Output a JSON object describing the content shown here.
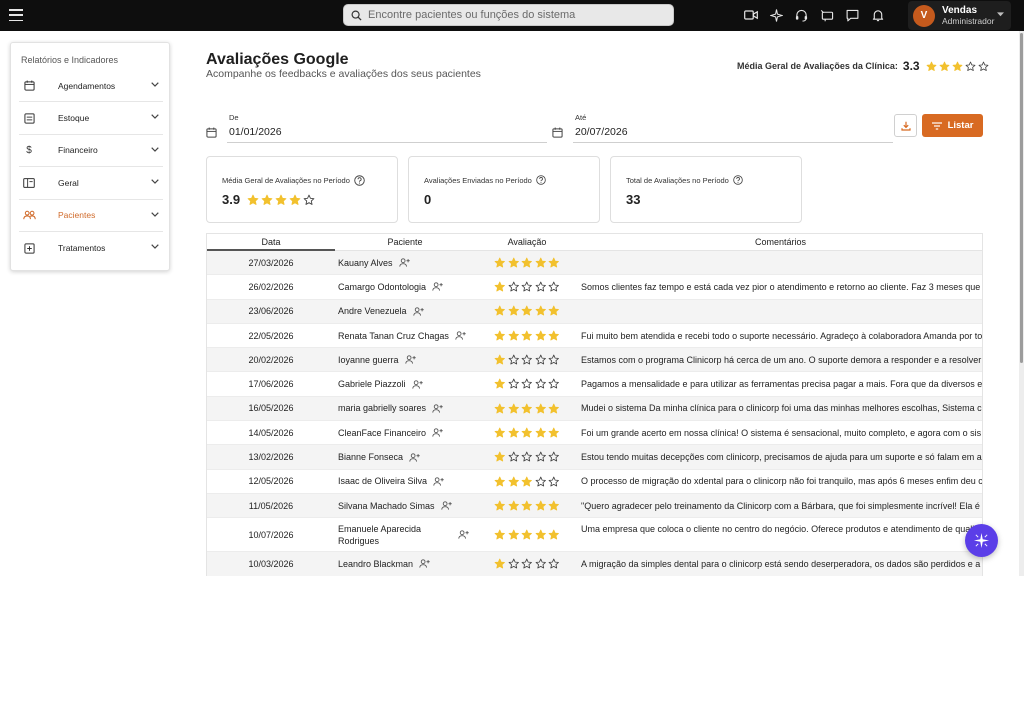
{
  "topbar": {
    "search_placeholder": "Encontre pacientes ou funções do sistema",
    "user": {
      "initial": "V",
      "name": "Vendas",
      "role": "Administrador"
    }
  },
  "sidebar": {
    "title": "Relatórios e Indicadores",
    "items": [
      {
        "label": "Agendamentos",
        "icon": "calendar-icon"
      },
      {
        "label": "Estoque",
        "icon": "inventory-icon"
      },
      {
        "label": "Financeiro",
        "icon": "dollar-icon"
      },
      {
        "label": "Geral",
        "icon": "panel-icon"
      },
      {
        "label": "Pacientes",
        "icon": "users-icon",
        "active": true
      },
      {
        "label": "Tratamentos",
        "icon": "plus-box-icon"
      }
    ]
  },
  "header": {
    "title": "Avaliações Google",
    "subtitle": "Acompanhe os feedbacks e avaliações dos seus pacientes",
    "avg_label": "Média Geral de Avaliações da Clínica:",
    "avg_value": "3.3",
    "avg_stars": 3
  },
  "filters": {
    "from_label": "De",
    "from_value": "01/01/2026",
    "to_label": "Até",
    "to_value": "20/07/2026",
    "list_button": "Listar"
  },
  "cards": [
    {
      "label": "Média Geral de Avaliações no Período",
      "value": "3.9",
      "stars": 4
    },
    {
      "label": "Avaliações Enviadas no Período",
      "value": "0"
    },
    {
      "label": "Total de Avaliações no Período",
      "value": "33"
    }
  ],
  "table": {
    "headers": {
      "date": "Data",
      "patient": "Paciente",
      "rating": "Avaliação",
      "comments": "Comentários"
    },
    "rows": [
      {
        "date": "27/03/2026",
        "patient": "Kauany Alves",
        "rating": 5,
        "comment": ""
      },
      {
        "date": "26/02/2026",
        "patient": "Camargo Odontologia",
        "rating": 1,
        "comment": "Somos clientes faz tempo e está cada vez pior o atendimento e retorno ao cliente. Faz 3 meses que"
      },
      {
        "date": "23/06/2026",
        "patient": "Andre Venezuela",
        "rating": 5,
        "comment": ""
      },
      {
        "date": "22/05/2026",
        "patient": "Renata Tanan Cruz Chagas",
        "rating": 5,
        "comment": "Fui muito bem atendida e recebi todo o suporte necessário. Agradeço à colaboradora Amanda por to"
      },
      {
        "date": "20/02/2026",
        "patient": "Ioyanne guerra",
        "rating": 1,
        "comment": "Estamos com o programa Clinicorp há cerca de um ano. O suporte demora a responder e a resolver"
      },
      {
        "date": "17/06/2026",
        "patient": "Gabriele Piazzoli",
        "rating": 1,
        "comment": "Pagamos a mensalidade e para utilizar as ferramentas precisa pagar a mais. Fora que da diversos e"
      },
      {
        "date": "16/05/2026",
        "patient": "maria gabrielly soares",
        "rating": 5,
        "comment": "Mudei o sistema Da minha clínica para o clinicorp foi uma das minhas melhores escolhas, Sistema c"
      },
      {
        "date": "14/05/2026",
        "patient": "CleanFace Financeiro",
        "rating": 5,
        "comment": "Foi um grande acerto em nossa clínica! O sistema é sensacional, muito completo, e agora com o sis"
      },
      {
        "date": "13/02/2026",
        "patient": "Bianne Fonseca",
        "rating": 1,
        "comment": "Estou tendo muitas decepções com clinicorp, precisamos de ajuda para um suporte e só falam em a"
      },
      {
        "date": "12/05/2026",
        "patient": "Isaac de Oliveira Silva",
        "rating": 3,
        "comment": "O processo de migração do xdental para o clinicorp não foi tranquilo, mas após 6 meses enfim deu c"
      },
      {
        "date": "11/05/2026",
        "patient": "Silvana Machado Simas",
        "rating": 5,
        "comment": "\"Quero agradecer pelo treinamento da Clinicorp com a Bárbara, que foi simplesmente incrível! Ela é e"
      },
      {
        "date": "10/07/2026",
        "patient": "Emanuele Aparecida Rodrigues",
        "rating": 5,
        "comment": "Uma empresa que coloca o cliente no centro do negócio. Oferece produtos e atendimento de qualid",
        "tall": true
      },
      {
        "date": "10/03/2026",
        "patient": "Leandro Blackman",
        "rating": 1,
        "comment": "A migração da simples dental para o clinicorp está sendo deserperadora, os dados são perdidos e a"
      }
    ]
  },
  "colors": {
    "accent": "#d86a22",
    "star": "#f2c12e",
    "fab": "#5b3ee8",
    "topbar": "#0e0e0e"
  }
}
